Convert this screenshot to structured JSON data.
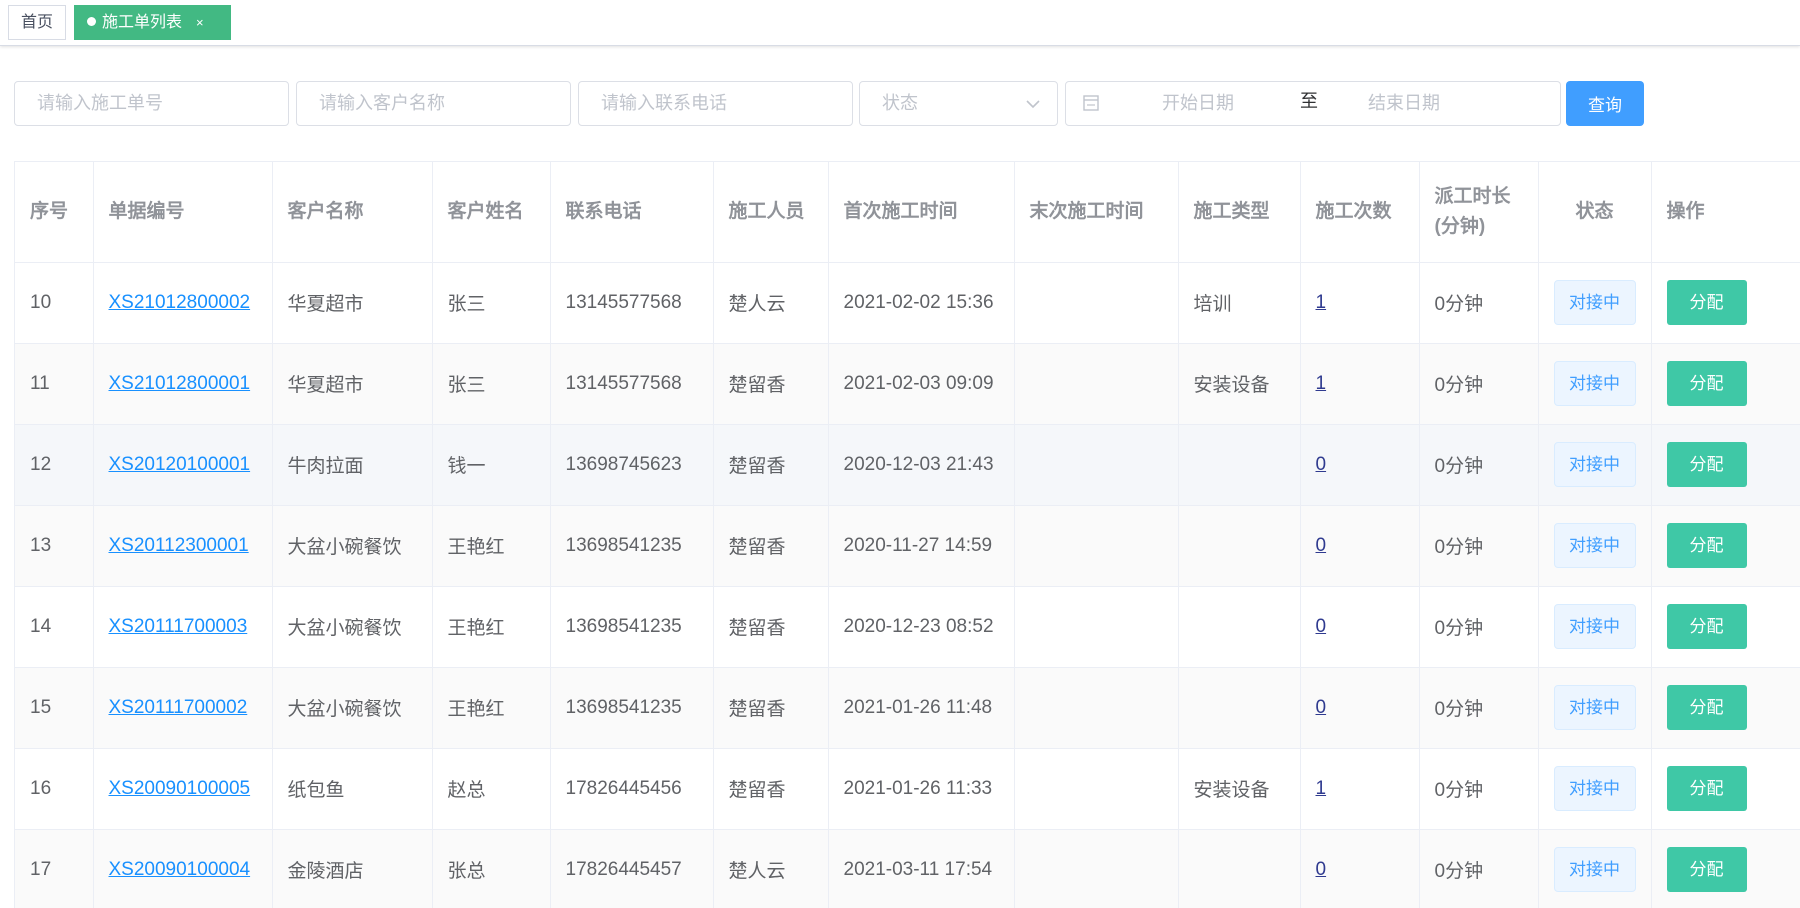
{
  "tabs": {
    "home": "首页",
    "active": "施工单列表",
    "close": "×"
  },
  "filters": {
    "order_no_placeholder": "请输入施工单号",
    "customer_placeholder": "请输入客户名称",
    "phone_placeholder": "请输入联系电话",
    "status_placeholder": "状态",
    "start_date_placeholder": "开始日期",
    "range_separator": "至",
    "end_date_placeholder": "结束日期",
    "query_label": "查询"
  },
  "table": {
    "columns": [
      "序号",
      "单据编号",
      "客户名称",
      "客户姓名",
      "联系电话",
      "施工人员",
      "首次施工时间",
      "末次施工时间",
      "施工类型",
      "施工次数",
      "派工时长(分钟)",
      "状态",
      "操作"
    ],
    "dispatch_header_line1": "派工时长",
    "dispatch_header_line2": "(分钟)",
    "rows": [
      {
        "index": "10",
        "code": "XS21012800002",
        "customer": "华夏超市",
        "contact": "张三",
        "phone": "13145577568",
        "worker": "楚人云",
        "first_time": "2021-02-02 15:36",
        "last_time": "",
        "type": "培训",
        "count": "1",
        "duration": "0分钟",
        "status": "对接中",
        "action": "分配"
      },
      {
        "index": "11",
        "code": "XS21012800001",
        "customer": "华夏超市",
        "contact": "张三",
        "phone": "13145577568",
        "worker": "楚留香",
        "first_time": "2021-02-03 09:09",
        "last_time": "",
        "type": "安装设备",
        "count": "1",
        "duration": "0分钟",
        "status": "对接中",
        "action": "分配"
      },
      {
        "index": "12",
        "code": "XS20120100001",
        "customer": "牛肉拉面",
        "contact": "钱一",
        "phone": "13698745623",
        "worker": "楚留香",
        "first_time": "2020-12-03 21:43",
        "last_time": "",
        "type": "",
        "count": "0",
        "duration": "0分钟",
        "status": "对接中",
        "action": "分配"
      },
      {
        "index": "13",
        "code": "XS20112300001",
        "customer": "大盆小碗餐饮",
        "contact": "王艳红",
        "phone": "13698541235",
        "worker": "楚留香",
        "first_time": "2020-11-27 14:59",
        "last_time": "",
        "type": "",
        "count": "0",
        "duration": "0分钟",
        "status": "对接中",
        "action": "分配"
      },
      {
        "index": "14",
        "code": "XS20111700003",
        "customer": "大盆小碗餐饮",
        "contact": "王艳红",
        "phone": "13698541235",
        "worker": "楚留香",
        "first_time": "2020-12-23 08:52",
        "last_time": "",
        "type": "",
        "count": "0",
        "duration": "0分钟",
        "status": "对接中",
        "action": "分配"
      },
      {
        "index": "15",
        "code": "XS20111700002",
        "customer": "大盆小碗餐饮",
        "contact": "王艳红",
        "phone": "13698541235",
        "worker": "楚留香",
        "first_time": "2021-01-26 11:48",
        "last_time": "",
        "type": "",
        "count": "0",
        "duration": "0分钟",
        "status": "对接中",
        "action": "分配"
      },
      {
        "index": "16",
        "code": "XS20090100005",
        "customer": "纸包鱼",
        "contact": "赵总",
        "phone": "17826445456",
        "worker": "楚留香",
        "first_time": "2021-01-26 11:33",
        "last_time": "",
        "type": "安装设备",
        "count": "1",
        "duration": "0分钟",
        "status": "对接中",
        "action": "分配"
      },
      {
        "index": "17",
        "code": "XS20090100004",
        "customer": "金陵酒店",
        "contact": "张总",
        "phone": "17826445457",
        "worker": "楚人云",
        "first_time": "2021-03-11 17:54",
        "last_time": "",
        "type": "",
        "count": "0",
        "duration": "0分钟",
        "status": "对接中",
        "action": "分配"
      }
    ]
  },
  "colors": {
    "active_tab": "#42b983",
    "primary": "#409eff",
    "assign_button": "#3fc8a6",
    "link": "#1890ff"
  },
  "icons": {
    "chevron": "chevron-down-icon",
    "calendar": "calendar-icon",
    "dot": "active-dot-icon"
  }
}
